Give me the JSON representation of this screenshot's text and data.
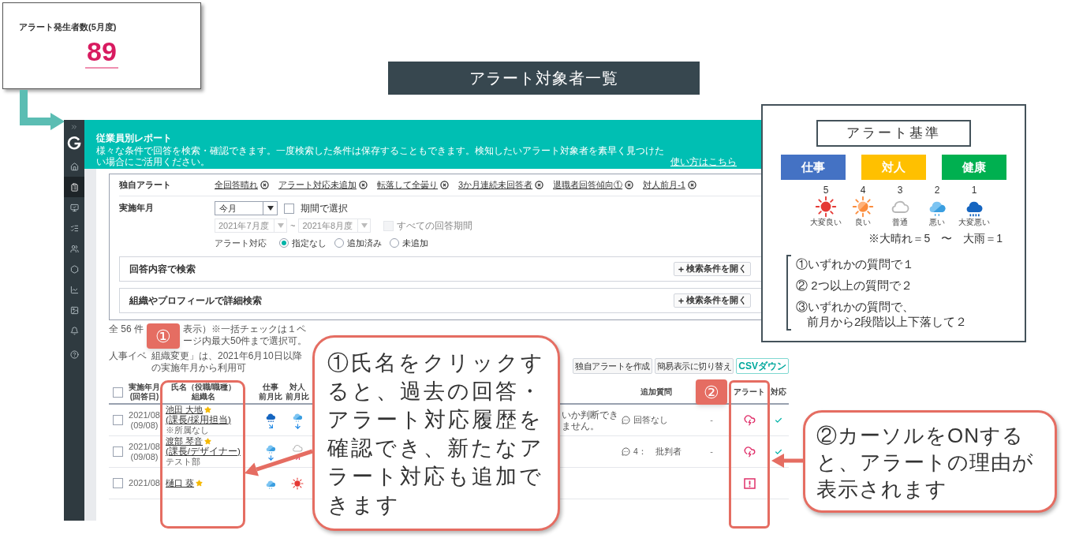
{
  "summary_card": {
    "label": "アラート発生者数(5月度)",
    "value": "89"
  },
  "banner": {
    "title": "アラート対象者一覧"
  },
  "app": {
    "sidebar_items": [
      {
        "selected": false
      },
      {
        "selected": true
      },
      {
        "selected": false
      },
      {
        "selected": false
      },
      {
        "selected": false
      },
      {
        "selected": false
      },
      {
        "selected": false
      },
      {
        "selected": false
      },
      {
        "selected": false
      },
      {
        "selected": false
      }
    ],
    "page_title": "従業員別レポート",
    "description": "様々な条件で回答を検索・確認できます。一度検索した条件は保存することもできます。検知したいアラート対象者を素早く見つけたい場合にご活用ください。",
    "help_link": "使い方はこちら",
    "custom_alert": {
      "label": "独自アラート",
      "tags": [
        "全回答晴れ",
        "アラート対応未追加",
        "転落して全曇り",
        "3か月連続未回答者",
        "退職者回答傾向①",
        "対人前月-1"
      ]
    },
    "period": {
      "label": "実施年月",
      "select": "今月",
      "range_checkbox": {
        "label": "期間で選択",
        "checked": false
      },
      "from": "2021年7月度",
      "separator": "~",
      "to": "2021年8月度",
      "all_checkbox": {
        "label": "すべての回答期間",
        "disabled": true
      }
    },
    "alert_response": {
      "label": "アラート対応",
      "options": [
        {
          "label": "指定なし",
          "selected": true
        },
        {
          "label": "追加済み",
          "selected": false
        },
        {
          "label": "未追加",
          "selected": false
        }
      ]
    },
    "sections": [
      {
        "title": "回答内容で検索",
        "button": "検索条件を開く"
      },
      {
        "title": "組織やプロフィールで詳細検索",
        "button": "検索条件を開く"
      }
    ],
    "notes": [
      "全 56 件",
      "表示）※一括チェックは１ページ内最大50件まで選択可。",
      "人事イベ",
      "組織変更」は、2021年6月10日以降の実施年月から利用可"
    ],
    "buttons": [
      {
        "label": "独自アラートを作成",
        "kind": "plain"
      },
      {
        "label": "簡易表示に切り替え",
        "kind": "plain"
      },
      {
        "label": "CSVダウン",
        "kind": "accent"
      }
    ],
    "table": {
      "select_all": {
        "checked": false
      },
      "columns": {
        "date": [
          "実施年月",
          "(回答日)"
        ],
        "name": [
          "氏名（役職/職種）",
          "組織名"
        ],
        "work": [
          "仕事",
          "前月比"
        ],
        "people": [
          "対人",
          "前月比"
        ],
        "extra": [
          "追加質問"
        ],
        "alert": [
          "アラート"
        ],
        "response": [
          "対応"
        ]
      },
      "rows": [
        {
          "checked": false,
          "period": "2021/08",
          "answered": "(09/08)",
          "name": "池田 大地",
          "starred": true,
          "role": "(課長/採用担当)",
          "org": "※所属なし",
          "work": {
            "weather": {
              "kind": "heavy_rain"
            },
            "trend": {
              "kind": "down_right"
            }
          },
          "people": {
            "weather": {
              "kind": "rain"
            },
            "trend": {
              "kind": "down"
            }
          },
          "comment": [
            "いか判断でき",
            "ません。"
          ],
          "extra": "回答なし",
          "dash": "-",
          "alert": {
            "kind": "storm"
          },
          "handled": true
        },
        {
          "checked": false,
          "period": "2021/08",
          "answered": "(09/08)",
          "name": "渡部 琴音",
          "starred": true,
          "role": "(課長/デザイナー)",
          "org": "テスト部",
          "work": {
            "weather": {
              "kind": "rain"
            },
            "trend": {
              "kind": "down"
            }
          },
          "people": {
            "weather": {
              "kind": "cloudy"
            },
            "trend": {
              "kind": "up_right"
            }
          },
          "extra": "4：　批判者",
          "dash": "-",
          "alert": {
            "kind": "storm"
          },
          "handled": true
        },
        {
          "checked": false,
          "period": "2021/08",
          "name": "樋口 葵",
          "starred": true,
          "work": {
            "weather": {
              "kind": "rain"
            }
          },
          "people": {
            "weather": {
              "kind": "sunny"
            }
          },
          "alert": {
            "kind": "warning"
          },
          "handled": false
        }
      ]
    }
  },
  "criteria": {
    "title": "アラート基準",
    "categories": [
      {
        "label": "仕事",
        "color": "#4472c4"
      },
      {
        "label": "対人",
        "color": "#ffc000"
      },
      {
        "label": "健康",
        "color": "#00b050"
      }
    ],
    "scale": [
      {
        "value": "5",
        "kind": "sunny",
        "caption": "大変良い"
      },
      {
        "value": "4",
        "kind": "partly_sunny",
        "caption": "良い"
      },
      {
        "value": "3",
        "kind": "cloudy",
        "caption": "普通"
      },
      {
        "value": "2",
        "kind": "rain",
        "caption": "悪い"
      },
      {
        "value": "1",
        "kind": "heavy_rain",
        "caption": "大変悪い"
      }
    ],
    "note": "※大晴れ＝5　〜　大雨＝1",
    "rules": [
      [
        "①いずれかの質問で１"
      ],
      [
        "② 2つ以上の質問で２"
      ],
      [
        "③いずれかの質問で、",
        "前月から2段階以上下落して２"
      ]
    ]
  },
  "badges": [
    "①",
    "②"
  ],
  "callouts": [
    {
      "text": "①氏名をクリックすると、過去の回答・アラート対応履歴を確認でき、新たなアラート対応も追加できます"
    },
    {
      "text": "②カーソルをONすると、アラートの理由が表示されます"
    }
  ]
}
